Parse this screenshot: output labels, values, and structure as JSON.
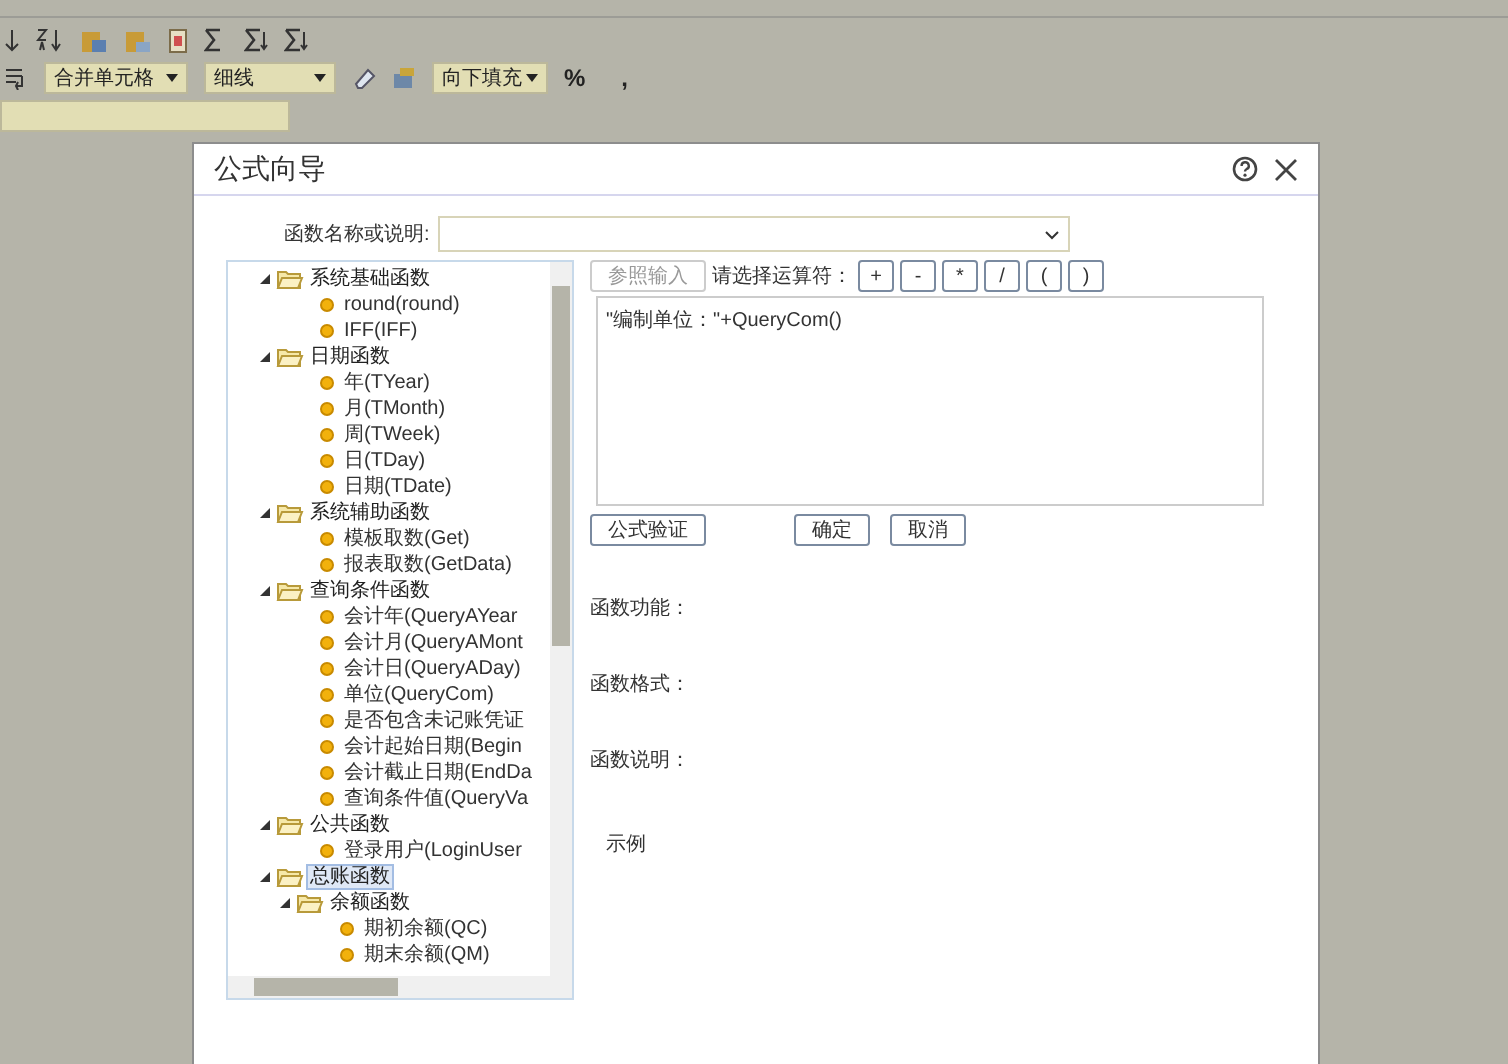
{
  "toolbar": {
    "merge_dropdown": "合并单元格",
    "line_dropdown": "细线",
    "fill_dropdown": "向下填充",
    "percent": "%",
    "comma": ","
  },
  "dialog": {
    "title": "公式向导",
    "search": {
      "label": "函数名称或说明:"
    },
    "tree": [
      {
        "label": "系统基础函数",
        "expanded": true,
        "selected": false,
        "children": [
          {
            "label": "round(round)",
            "selected": false
          },
          {
            "label": "IFF(IFF)",
            "selected": false
          }
        ]
      },
      {
        "label": "日期函数",
        "expanded": true,
        "selected": false,
        "children": [
          {
            "label": "年(TYear)",
            "selected": false
          },
          {
            "label": "月(TMonth)",
            "selected": false
          },
          {
            "label": "周(TWeek)",
            "selected": false
          },
          {
            "label": "日(TDay)",
            "selected": false
          },
          {
            "label": "日期(TDate)",
            "selected": false
          }
        ]
      },
      {
        "label": "系统辅助函数",
        "expanded": true,
        "selected": false,
        "children": [
          {
            "label": "模板取数(Get)",
            "selected": false
          },
          {
            "label": "报表取数(GetData)",
            "selected": false
          }
        ]
      },
      {
        "label": "查询条件函数",
        "expanded": true,
        "selected": false,
        "children": [
          {
            "label": "会计年(QueryAYear",
            "selected": false
          },
          {
            "label": "会计月(QueryAMont",
            "selected": false
          },
          {
            "label": "会计日(QueryADay)",
            "selected": false
          },
          {
            "label": "单位(QueryCom)",
            "selected": false
          },
          {
            "label": "是否包含未记账凭证",
            "selected": false
          },
          {
            "label": "会计起始日期(Begin",
            "selected": false
          },
          {
            "label": "会计截止日期(EndDa",
            "selected": false
          },
          {
            "label": "查询条件值(QueryVa",
            "selected": false
          }
        ]
      },
      {
        "label": "公共函数",
        "expanded": true,
        "selected": false,
        "children": [
          {
            "label": "登录用户(LoginUser",
            "selected": false
          }
        ]
      },
      {
        "label": "总账函数",
        "expanded": true,
        "selected": true,
        "children": [
          {
            "label": "余额函数",
            "expanded": true,
            "selected": false,
            "children": [
              {
                "label": "期初余额(QC)",
                "selected": false
              },
              {
                "label": "期末余额(QM)",
                "selected": false
              }
            ]
          }
        ]
      }
    ],
    "reference_button": {
      "label": "参照输入",
      "disabled": true
    },
    "operator_label": "请选择运算符：",
    "operators": [
      "+",
      "-",
      "*",
      "/",
      "(",
      ")"
    ],
    "formula": "\"编制单位：\"+QueryCom()",
    "verify_button": "公式验证",
    "ok_button": "确定",
    "cancel_button": "取消",
    "info_labels": [
      "函数功能：",
      "函数格式：",
      "函数说明："
    ],
    "example_label": "示例"
  }
}
